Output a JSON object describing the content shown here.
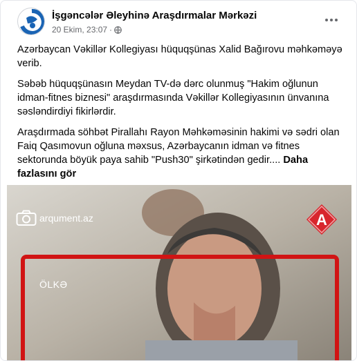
{
  "post": {
    "page_name": "İşgəncələr Əleyhinə Araşdırmalar Mərkəzi",
    "date": "20 Ekim, 23:07",
    "separator": "·",
    "privacy_icon": "globe-icon",
    "more_icon": "more-horizontal-icon",
    "paragraphs": [
      "Azərbaycan Vəkillər Kollegiyası hüquqşünas Xalid Bağırovu məhkəməyə verib.",
      "Səbəb hüquqşünasın Meydan TV-də dərc olunmuş \"Hakim oğlunun idman-fitnes biznesi\" araşdırmasında Vəkillər Kollegiyasının ünvanına səsləndirdiyi fikirlərdir.",
      "Araşdırmada söhbət Pirallahı Rayon Məhkəməsinin hakimi və sədri olan Faiq Qasımovun oğluna məxsus, Azərbaycanın idman və fitnes sektorunda böyük paya sahib \"Push30\" şirkətindən gedir...."
    ],
    "see_more": "Daha fazlasını gör"
  },
  "media": {
    "source_label": "arqument.az",
    "camera_icon": "camera-icon",
    "badge_letter": "A",
    "tag_label": "ÖLKƏ",
    "colors": {
      "frame": "#d11414",
      "badge": "#d8262d"
    }
  }
}
